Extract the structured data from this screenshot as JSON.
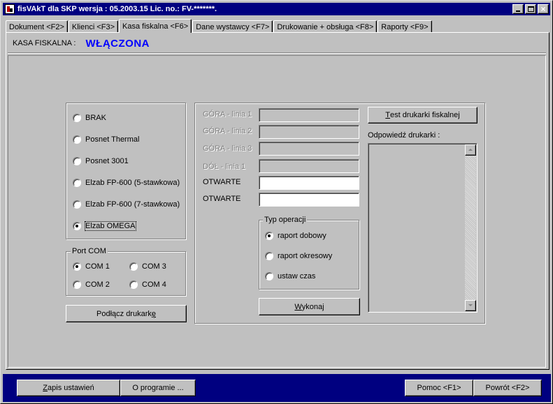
{
  "window": {
    "title": "fisVAkT  dla SKP  wersja : 05.2003.15 Lic. no.: FV-*******."
  },
  "tabs": [
    {
      "label": "Dokument <F2>"
    },
    {
      "label": "Klienci <F3>"
    },
    {
      "label": "Kasa fiskalna <F6>"
    },
    {
      "label": "Dane wystawcy <F7>"
    },
    {
      "label": "Drukowanie + obsługa <F8>"
    },
    {
      "label": "Raporty <F9>"
    }
  ],
  "status": {
    "label": "KASA FISKALNA :",
    "value": "WŁĄCZONA",
    "value_color": "#0000ff"
  },
  "printers": {
    "options": [
      {
        "label": "BRAK",
        "checked": false
      },
      {
        "label": "Posnet Thermal",
        "checked": false
      },
      {
        "label": "Posnet 3001",
        "checked": false
      },
      {
        "label": "Elzab FP-600 (5-stawkowa)",
        "checked": false
      },
      {
        "label": "Elzab FP-600 (7-stawkowa)",
        "checked": false
      },
      {
        "label": "Elzab OMEGA",
        "checked": true
      }
    ]
  },
  "port_com": {
    "title": "Port COM",
    "options": [
      {
        "label": "COM 1",
        "checked": true
      },
      {
        "label": "COM 3",
        "checked": false
      },
      {
        "label": "COM 2",
        "checked": false
      },
      {
        "label": "COM 4",
        "checked": false
      }
    ]
  },
  "connect_button": {
    "label_prefix": "Podłącz drukark",
    "label_underlined": "ę"
  },
  "display_lines": [
    {
      "label": "GÓRA - linia 1",
      "value": "",
      "enabled": false
    },
    {
      "label": "GÓRA - linia 2",
      "value": "",
      "enabled": false
    },
    {
      "label": "GÓRA - linia 3",
      "value": "",
      "enabled": false
    },
    {
      "label": "DÓŁ - linia 1",
      "value": "",
      "enabled": false
    },
    {
      "label": "OTWARTE",
      "value": "",
      "enabled": true
    },
    {
      "label": "OTWARTE",
      "value": "",
      "enabled": true
    }
  ],
  "operation": {
    "title": "Typ operacji",
    "options": [
      {
        "label": "raport dobowy",
        "checked": true
      },
      {
        "label": "raport okresowy",
        "checked": false
      },
      {
        "label": "ustaw czas",
        "checked": false
      }
    ]
  },
  "execute_button": {
    "underlined": "W",
    "rest": "ykonaj"
  },
  "test_button": {
    "underlined": "T",
    "rest": "est drukarki fiskalnej"
  },
  "response": {
    "label": "Odpowiedź drukarki :"
  },
  "footer": {
    "save_underlined": "Z",
    "save_rest": "apis ustawień",
    "about_label": "O programie ...",
    "help_label": "Pomoc <F1>",
    "back_label": "Powrót <F2>"
  },
  "colors": {
    "face": "#c0c0c0",
    "titlebar": "#000080",
    "footer": "#000080"
  }
}
